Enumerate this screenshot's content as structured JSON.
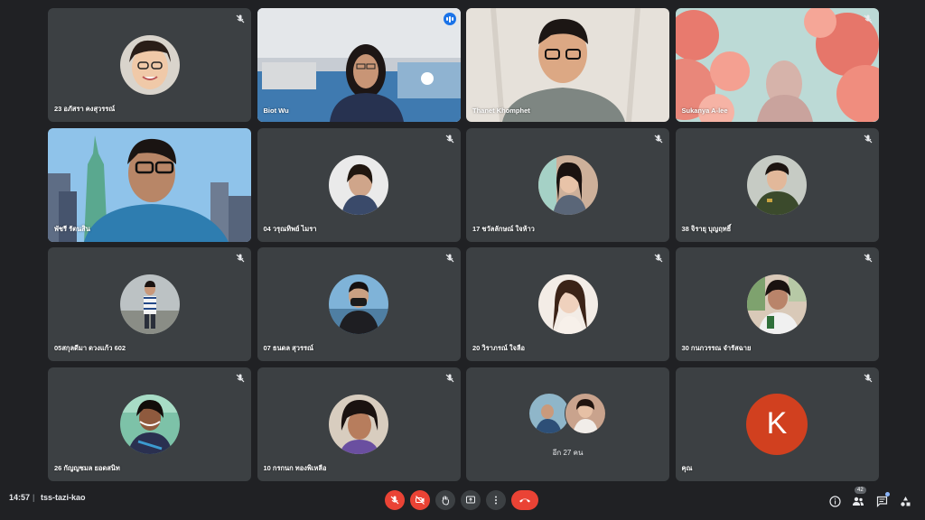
{
  "tiles": [
    {
      "name": "23 อภัสรา คงสุวรรณ์",
      "mic_muted": true
    },
    {
      "name": "Biot Wu",
      "speaking": true
    },
    {
      "name": "Thanet Khomphet",
      "mic_muted": false
    },
    {
      "name": "Sukanya A-lee",
      "mic_muted": true
    },
    {
      "name": "พัชรี รัตนสิน",
      "mic_muted": false
    },
    {
      "name": "04 วรุณทิพย์ ไมรา",
      "mic_muted": true
    },
    {
      "name": "17 ชวัลลักษณ์ ใจห้าว",
      "mic_muted": true
    },
    {
      "name": "38 จิรายุ บุญฤทธิ์",
      "mic_muted": true
    },
    {
      "name": "05สกุลดีมา ดวงแก้ว 602",
      "mic_muted": true
    },
    {
      "name": "07 ธนดล สุวรรณ์",
      "mic_muted": true
    },
    {
      "name": "20 วิราภรณ์ ใจลือ",
      "mic_muted": true
    },
    {
      "name": "30 กนกวรรณ จำรัสฉาย",
      "mic_muted": true
    },
    {
      "name": "26 กัญญชมล ยอดสนิท",
      "mic_muted": true
    },
    {
      "name": "10 กรกนก ทองพิเหลือ",
      "mic_muted": true
    },
    {
      "name": "อีก 27 คน",
      "others_count": 27
    },
    {
      "name": "คุณ",
      "avatar_letter": "K",
      "avatar_color": "#d1401f",
      "mic_muted": true
    }
  ],
  "bottom_bar": {
    "time": "14:57",
    "separator": "|",
    "meeting_code": "tss-tazi-kao",
    "participants_badge": "42"
  },
  "colors": {
    "background": "#202124",
    "tile": "#3c4043",
    "danger": "#ea4335",
    "accent": "#8ab4f8"
  }
}
